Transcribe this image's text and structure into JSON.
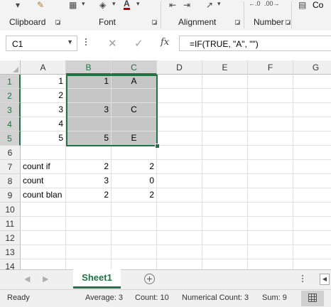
{
  "ribbon": {
    "groups": [
      {
        "label": "Clipboard"
      },
      {
        "label": "Font"
      },
      {
        "label": "Alignment"
      },
      {
        "label": "Number"
      }
    ],
    "font_color_accent": "#c00000",
    "fill_color_accent": "#ffff00",
    "truncated_label": "Co"
  },
  "formula_bar": {
    "name_box": "C1",
    "fx_label": "fx",
    "formula": "=IF(TRUE, \"A\", \"\")"
  },
  "grid": {
    "columns": [
      "A",
      "B",
      "C",
      "D",
      "E",
      "F",
      "G"
    ],
    "rows": [
      "1",
      "2",
      "3",
      "4",
      "5",
      "6",
      "7",
      "8",
      "9",
      "10",
      "11",
      "12",
      "13",
      "14"
    ],
    "cells": {
      "A1": "1",
      "B1": "1",
      "C1": "A",
      "A2": "2",
      "A3": "3",
      "B3": "3",
      "C3": "C",
      "A4": "4",
      "A5": "5",
      "B5": "5",
      "C5": "E",
      "A7": "count if",
      "B7": "2",
      "C7": "2",
      "A8": "count",
      "B8": "3",
      "C8": "0",
      "A9": "count blan",
      "B9": "2",
      "C9": "2"
    },
    "selection": "B1:C5",
    "accent": "#217346"
  },
  "sheet_tabs": {
    "active": "Sheet1",
    "add_symbol": "+"
  },
  "status_bar": {
    "mode": "Ready",
    "average": "Average: 3",
    "count": "Count: 10",
    "numerical_count": "Numerical Count: 3",
    "sum": "Sum: 9"
  }
}
